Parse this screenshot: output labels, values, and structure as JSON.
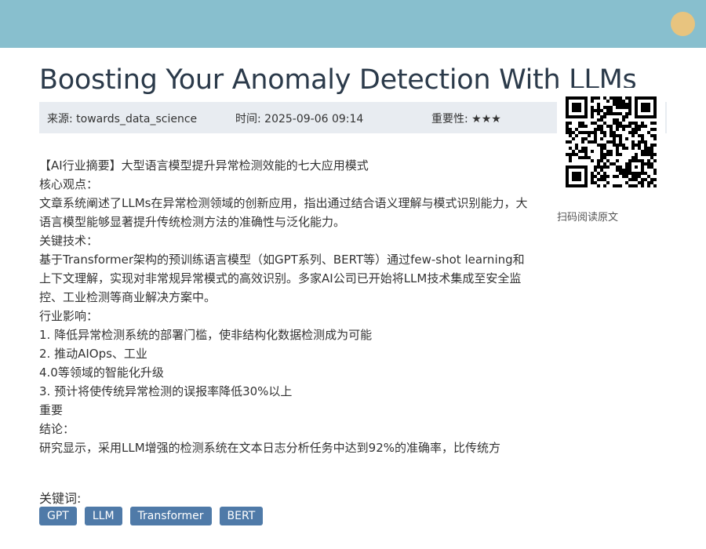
{
  "title": "Boosting Your Anomaly Detection With LLMs",
  "meta": {
    "source": "来源: towards_data_science",
    "time": "时间: 2025-09-06 09:14",
    "importance": "重要性: ★★★"
  },
  "qr": {
    "caption": "扫码阅读原文"
  },
  "content": {
    "summary_title": "【AI行业摘要】大型语言模型提升异常检测效能的七大应用模式",
    "core_label": "核心观点：",
    "core_text": "文章系统阐述了LLMs在异常检测领域的创新应用，指出通过结合语义理解与模式识别能力，大语言模型能够显著提升传统检测方法的准确性与泛化能力。",
    "tech_label": "关键技术：",
    "tech_text": "基于Transformer架构的预训练语言模型（如GPT系列、BERT等）通过few-shot learning和上下文理解，实现对非常规异常模式的高效识别。多家AI公司已开始将LLM技术集成至安全监控、工业检测等商业解决方案中。",
    "impact_label": "行业影响：",
    "impact_1": "1. 降低异常检测系统的部署门槛，使非结构化数据检测成为可能",
    "impact_2a": "2. 推动AIOps、工业",
    "impact_2b": "4.0等领域的智能化升级",
    "impact_3": "3. 预计将使传统异常检测的误报率降低30%以上",
    "important_label": "重要",
    "conclusion_label": "结论：",
    "conclusion_text": "研究显示，采用LLM增强的检测系统在文本日志分析任务中达到92%的准确率，比传统方"
  },
  "keywords": {
    "label": "关键词:",
    "tags": [
      "GPT",
      "LLM",
      "Transformer",
      "BERT"
    ]
  },
  "colors": {
    "header": "#88bfce",
    "avatar": "#e8c47f",
    "meta_bg": "#e8ecf1",
    "tag_bg": "#4f7aa8"
  }
}
